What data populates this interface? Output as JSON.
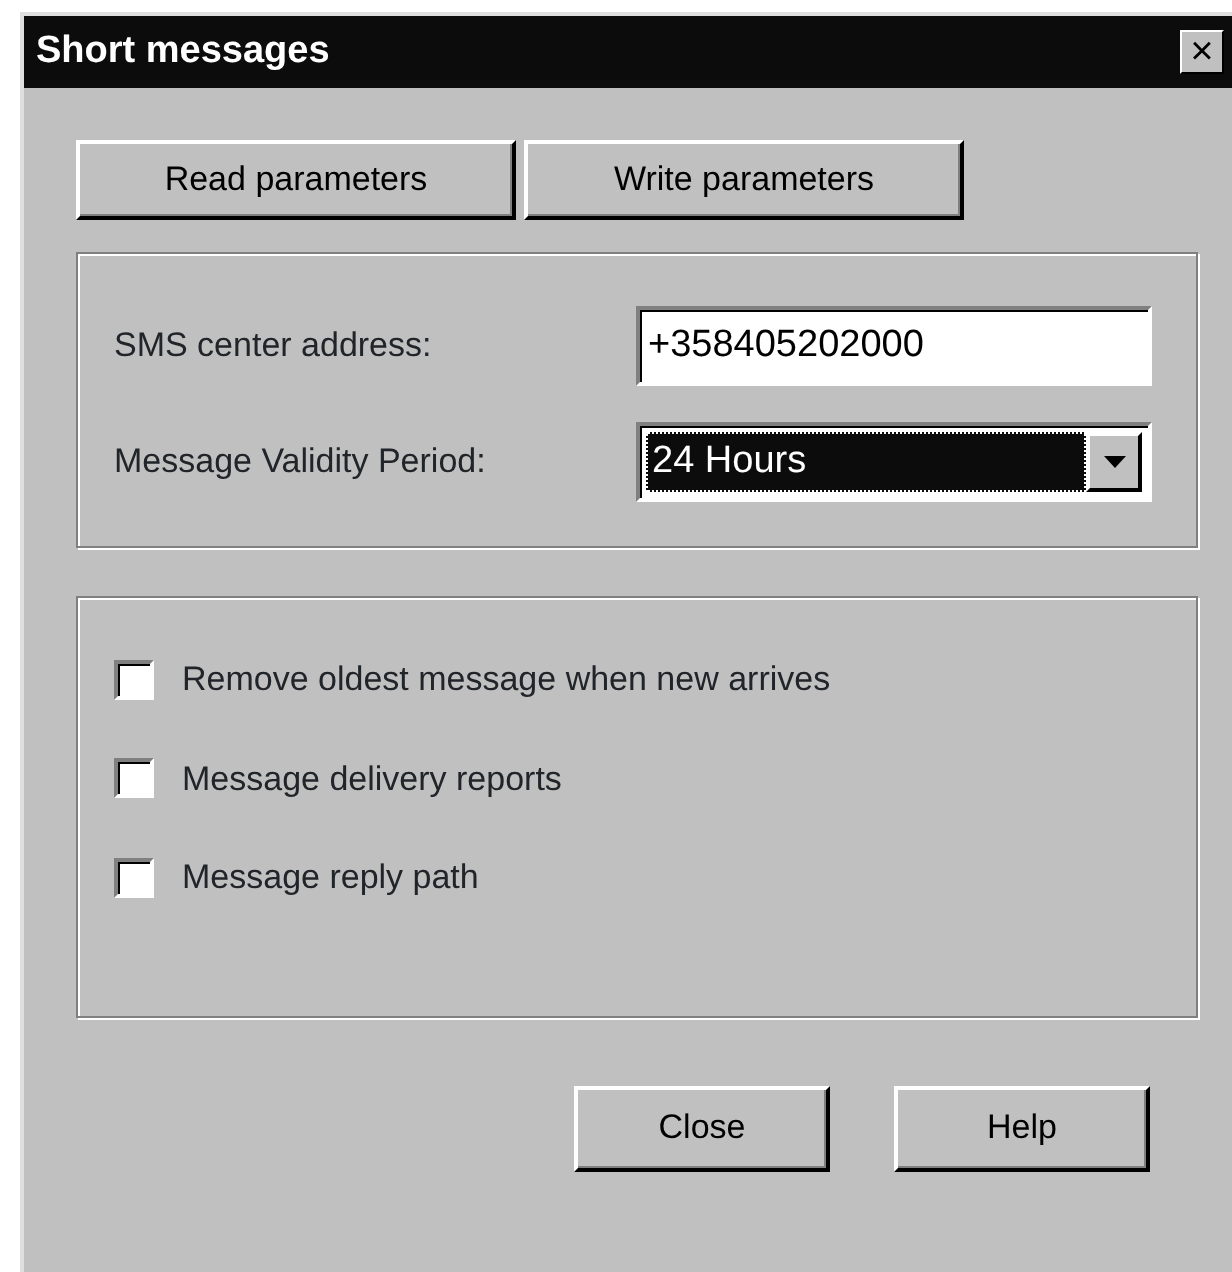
{
  "window": {
    "title": "Short messages",
    "close_glyph": "×"
  },
  "toolbar_buttons": [
    "Read parameters",
    "Write parameters"
  ],
  "fields": [
    {
      "kind": "text",
      "label": "SMS center address:",
      "value": "+358405202000"
    },
    {
      "kind": "dropdown",
      "label": "Message Validity Period:",
      "value": "24 Hours"
    }
  ],
  "options": [
    {
      "label": "Remove oldest message when new arrives",
      "checked": false
    },
    {
      "label": "Message delivery reports",
      "checked": false
    },
    {
      "label": "Message reply path",
      "checked": false
    }
  ],
  "buttons": [
    "Close",
    "Help"
  ]
}
